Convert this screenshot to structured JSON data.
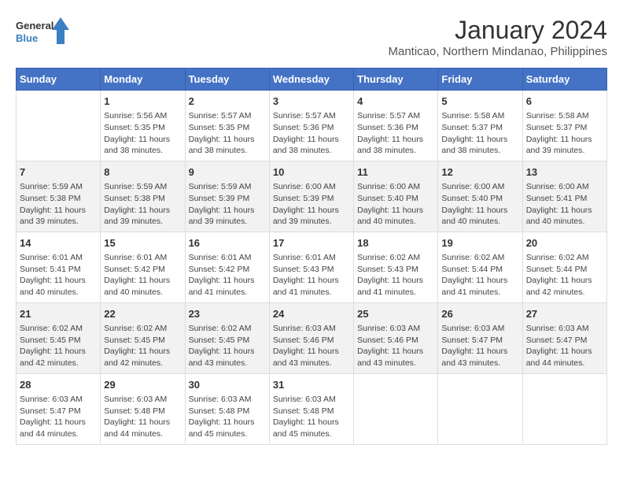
{
  "header": {
    "logo_general": "General",
    "logo_blue": "Blue",
    "title": "January 2024",
    "subtitle": "Manticao, Northern Mindanao, Philippines"
  },
  "days_of_week": [
    "Sunday",
    "Monday",
    "Tuesday",
    "Wednesday",
    "Thursday",
    "Friday",
    "Saturday"
  ],
  "weeks": [
    [
      {
        "day": "",
        "content": ""
      },
      {
        "day": "1",
        "content": "Sunrise: 5:56 AM\nSunset: 5:35 PM\nDaylight: 11 hours and 38 minutes."
      },
      {
        "day": "2",
        "content": "Sunrise: 5:57 AM\nSunset: 5:35 PM\nDaylight: 11 hours and 38 minutes."
      },
      {
        "day": "3",
        "content": "Sunrise: 5:57 AM\nSunset: 5:36 PM\nDaylight: 11 hours and 38 minutes."
      },
      {
        "day": "4",
        "content": "Sunrise: 5:57 AM\nSunset: 5:36 PM\nDaylight: 11 hours and 38 minutes."
      },
      {
        "day": "5",
        "content": "Sunrise: 5:58 AM\nSunset: 5:37 PM\nDaylight: 11 hours and 38 minutes."
      },
      {
        "day": "6",
        "content": "Sunrise: 5:58 AM\nSunset: 5:37 PM\nDaylight: 11 hours and 39 minutes."
      }
    ],
    [
      {
        "day": "7",
        "content": "Sunrise: 5:59 AM\nSunset: 5:38 PM\nDaylight: 11 hours and 39 minutes."
      },
      {
        "day": "8",
        "content": "Sunrise: 5:59 AM\nSunset: 5:38 PM\nDaylight: 11 hours and 39 minutes."
      },
      {
        "day": "9",
        "content": "Sunrise: 5:59 AM\nSunset: 5:39 PM\nDaylight: 11 hours and 39 minutes."
      },
      {
        "day": "10",
        "content": "Sunrise: 6:00 AM\nSunset: 5:39 PM\nDaylight: 11 hours and 39 minutes."
      },
      {
        "day": "11",
        "content": "Sunrise: 6:00 AM\nSunset: 5:40 PM\nDaylight: 11 hours and 40 minutes."
      },
      {
        "day": "12",
        "content": "Sunrise: 6:00 AM\nSunset: 5:40 PM\nDaylight: 11 hours and 40 minutes."
      },
      {
        "day": "13",
        "content": "Sunrise: 6:00 AM\nSunset: 5:41 PM\nDaylight: 11 hours and 40 minutes."
      }
    ],
    [
      {
        "day": "14",
        "content": "Sunrise: 6:01 AM\nSunset: 5:41 PM\nDaylight: 11 hours and 40 minutes."
      },
      {
        "day": "15",
        "content": "Sunrise: 6:01 AM\nSunset: 5:42 PM\nDaylight: 11 hours and 40 minutes."
      },
      {
        "day": "16",
        "content": "Sunrise: 6:01 AM\nSunset: 5:42 PM\nDaylight: 11 hours and 41 minutes."
      },
      {
        "day": "17",
        "content": "Sunrise: 6:01 AM\nSunset: 5:43 PM\nDaylight: 11 hours and 41 minutes."
      },
      {
        "day": "18",
        "content": "Sunrise: 6:02 AM\nSunset: 5:43 PM\nDaylight: 11 hours and 41 minutes."
      },
      {
        "day": "19",
        "content": "Sunrise: 6:02 AM\nSunset: 5:44 PM\nDaylight: 11 hours and 41 minutes."
      },
      {
        "day": "20",
        "content": "Sunrise: 6:02 AM\nSunset: 5:44 PM\nDaylight: 11 hours and 42 minutes."
      }
    ],
    [
      {
        "day": "21",
        "content": "Sunrise: 6:02 AM\nSunset: 5:45 PM\nDaylight: 11 hours and 42 minutes."
      },
      {
        "day": "22",
        "content": "Sunrise: 6:02 AM\nSunset: 5:45 PM\nDaylight: 11 hours and 42 minutes."
      },
      {
        "day": "23",
        "content": "Sunrise: 6:02 AM\nSunset: 5:45 PM\nDaylight: 11 hours and 43 minutes."
      },
      {
        "day": "24",
        "content": "Sunrise: 6:03 AM\nSunset: 5:46 PM\nDaylight: 11 hours and 43 minutes."
      },
      {
        "day": "25",
        "content": "Sunrise: 6:03 AM\nSunset: 5:46 PM\nDaylight: 11 hours and 43 minutes."
      },
      {
        "day": "26",
        "content": "Sunrise: 6:03 AM\nSunset: 5:47 PM\nDaylight: 11 hours and 43 minutes."
      },
      {
        "day": "27",
        "content": "Sunrise: 6:03 AM\nSunset: 5:47 PM\nDaylight: 11 hours and 44 minutes."
      }
    ],
    [
      {
        "day": "28",
        "content": "Sunrise: 6:03 AM\nSunset: 5:47 PM\nDaylight: 11 hours and 44 minutes."
      },
      {
        "day": "29",
        "content": "Sunrise: 6:03 AM\nSunset: 5:48 PM\nDaylight: 11 hours and 44 minutes."
      },
      {
        "day": "30",
        "content": "Sunrise: 6:03 AM\nSunset: 5:48 PM\nDaylight: 11 hours and 45 minutes."
      },
      {
        "day": "31",
        "content": "Sunrise: 6:03 AM\nSunset: 5:48 PM\nDaylight: 11 hours and 45 minutes."
      },
      {
        "day": "",
        "content": ""
      },
      {
        "day": "",
        "content": ""
      },
      {
        "day": "",
        "content": ""
      }
    ]
  ]
}
